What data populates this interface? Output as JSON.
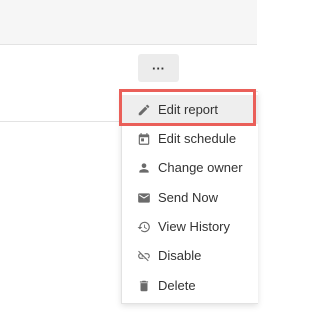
{
  "toolbar": {
    "more_button_label": "···",
    "more_button_icon": "more-horizontal-icon"
  },
  "menu": {
    "items": [
      {
        "label": "Edit report",
        "icon": "pencil-icon",
        "highlighted": true
      },
      {
        "label": "Edit schedule",
        "icon": "calendar-icon",
        "highlighted": false
      },
      {
        "label": "Change owner",
        "icon": "person-icon",
        "highlighted": false
      },
      {
        "label": "Send Now",
        "icon": "envelope-icon",
        "highlighted": false
      },
      {
        "label": "View History",
        "icon": "history-icon",
        "highlighted": false
      },
      {
        "label": "Disable",
        "icon": "link-off-icon",
        "highlighted": false
      },
      {
        "label": "Delete",
        "icon": "trash-icon",
        "highlighted": false
      }
    ]
  },
  "colors": {
    "highlight_border": "#ea5f59",
    "highlight_bg": "#eeeeee",
    "icon_color": "#6b6b6b",
    "text_color": "#333333"
  }
}
